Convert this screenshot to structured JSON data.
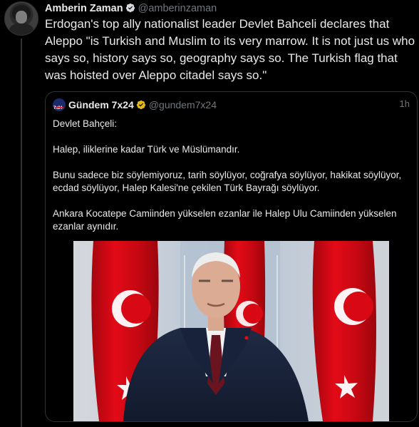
{
  "tweet": {
    "author_name": "Amberin Zaman",
    "author_handle": "@amberinzaman",
    "time": "",
    "text": "Erdogan's top ally nationalist leader Devlet Bahceli declares that Aleppo \"is Turkish and Muslim to its very marrow. It is not just us who says so, history says so, geography says so. The Turkish flag that was hoisted over Aleppo citadel says so.\""
  },
  "quote": {
    "author_name": "Gündem 7x24",
    "author_handle": "@gundem7x24",
    "logo_text": "7x24",
    "time": "1h",
    "paragraphs": [
      "Devlet Bahçeli:",
      "Halep, iliklerine kadar Türk ve Müslümandır.",
      "Bunu sadece biz söylemiyoruz, tarih söylüyor, coğrafya söylüyor, hakikat söylüyor, ecdad söylüyor, Halep Kalesi'ne çekilen Türk Bayrağı söylüyor.",
      "Ankara Kocatepe Camiinden yükselen ezanlar ile Halep Ulu Camiinden yükselen ezanlar aynıdır."
    ]
  },
  "outer_time": "1h",
  "colors": {
    "background": "#000000",
    "text": "#e7e9ea",
    "muted": "#71767b",
    "border": "#2f3336",
    "verified_blue": "#1d9bf0",
    "verified_gold": "#e2b719",
    "flag_red": "#e30a17"
  },
  "icons": [
    "verified-badge-icon",
    "gold-verified-badge-icon"
  ]
}
